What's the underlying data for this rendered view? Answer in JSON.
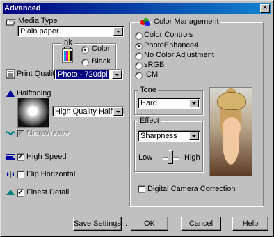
{
  "window": {
    "title": "Advanced",
    "close": "×"
  },
  "media": {
    "label": "Media Type",
    "value": "Plain paper"
  },
  "ink": {
    "label": "Ink",
    "options": [
      "Color",
      "Black"
    ],
    "selected": "Color"
  },
  "print_quality": {
    "label": "Print Quality",
    "value": "Photo - 720dpi"
  },
  "halftoning": {
    "label": "Halftoning",
    "value": "High Quality Halftoning"
  },
  "options": {
    "microweave": {
      "label": "MicroWeave",
      "checked": true,
      "enabled": false
    },
    "high_speed": {
      "label": "High Speed",
      "checked": true
    },
    "flip_horizontal": {
      "label": "Flip Horizontal",
      "checked": false
    },
    "finest_detail": {
      "label": "Finest Detail",
      "checked": true
    }
  },
  "color_management": {
    "title": "Color Management",
    "options": [
      "Color Controls",
      "PhotoEnhance4",
      "No Color Adjustment",
      "sRGB",
      "ICM"
    ],
    "selected": "PhotoEnhance4"
  },
  "tone": {
    "label": "Tone",
    "value": "Hard"
  },
  "effect": {
    "label": "Effect",
    "value": "Sharpness",
    "low": "Low",
    "high": "High"
  },
  "digital_camera": {
    "label": "Digital Camera Correction",
    "checked": false
  },
  "buttons": {
    "save": "Save Settings...",
    "ok": "OK",
    "cancel": "Cancel",
    "help": "Help"
  }
}
